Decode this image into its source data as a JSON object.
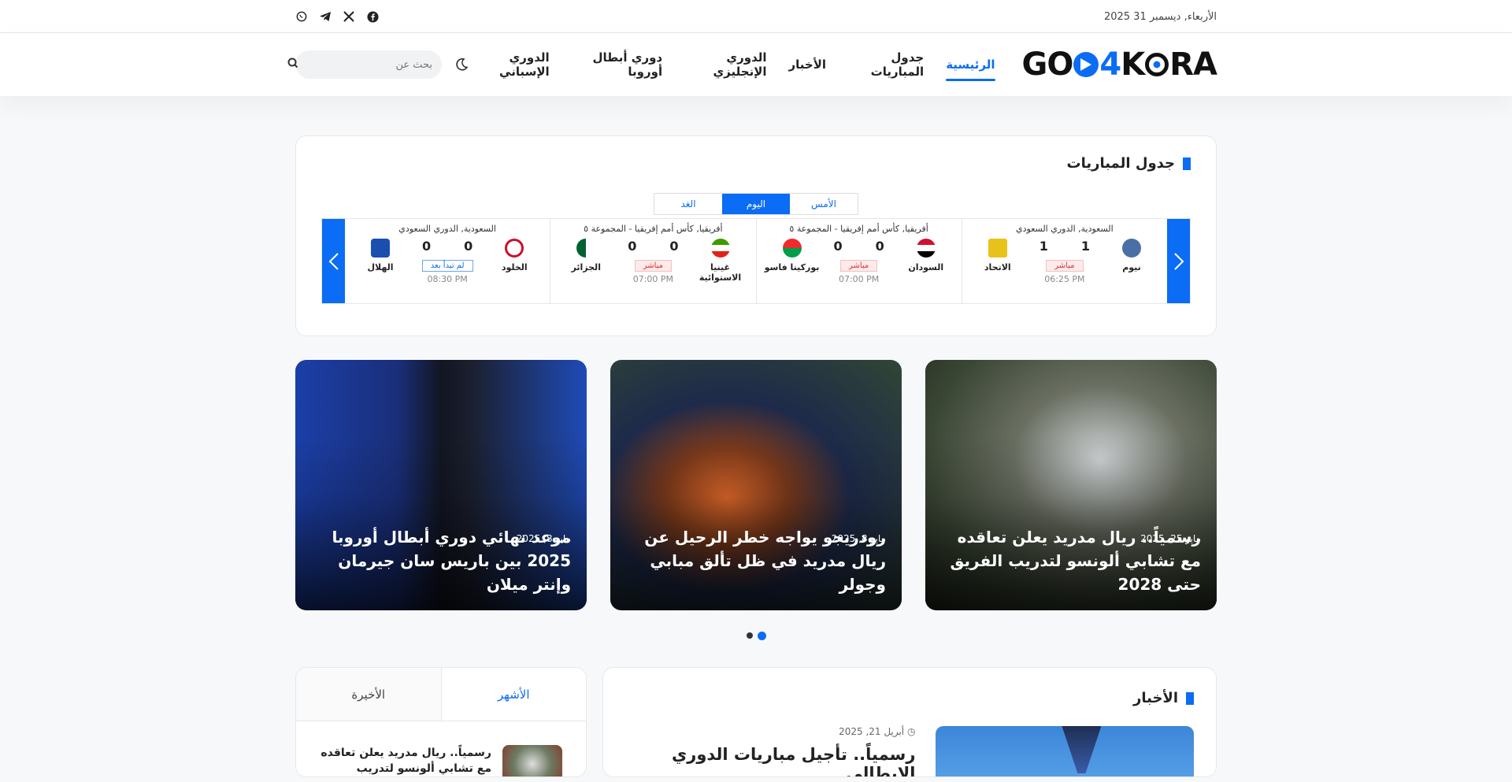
{
  "topbar": {
    "date": "الأربعاء, ديسمبر 31 2025",
    "social": [
      "facebook-icon",
      "x-icon",
      "telegram-icon",
      "whatsapp-icon"
    ]
  },
  "header": {
    "logo": {
      "go": "GO",
      "four": "4",
      "k": "K",
      "ra": "RA"
    },
    "nav": [
      "الرئيسية",
      "جدول المباريات",
      "الأخبار",
      "الدوري الإنجليزي",
      "دوري أبطال أوروبا",
      "الدوري الإسباني"
    ],
    "search_placeholder": "بحث عن"
  },
  "matches": {
    "title": "جدول المباريات",
    "tabs": [
      "الأمس",
      "اليوم",
      "الغد"
    ],
    "active_tab": "اليوم",
    "games": [
      {
        "league": "السعودية, الدوري السعودي",
        "home": "نيوم",
        "away": "الاتحاد",
        "home_score": "1",
        "away_score": "1",
        "status": "مباشر",
        "time": "06:25 PM",
        "home_color": "#4a6fa5",
        "away_color": "#e8c21a"
      },
      {
        "league": "أفريقيا, كأس أمم إفريقيا - المجموعة ٥",
        "home": "السودان",
        "away": "بوركينا فاسو",
        "home_score": "0",
        "away_score": "0",
        "status": "مباشر",
        "time": "07:00 PM",
        "home_color": "#d21034",
        "away_color": "#009e49"
      },
      {
        "league": "أفريقيا, كأس أمم إفريقيا - المجموعة ٥",
        "home": "غينيا الاستوائية",
        "away": "الجزائر",
        "home_score": "0",
        "away_score": "0",
        "status": "مباشر",
        "time": "07:00 PM",
        "home_color": "#3e9a00",
        "away_color": "#006233"
      },
      {
        "league": "السعودية, الدوري السعودي",
        "home": "الخلود",
        "away": "الهلال",
        "home_score": "0",
        "away_score": "0",
        "status": "لم تبدأ بعد",
        "time": "08:30 PM",
        "home_color": "#c8102e",
        "away_color": "#1a4fb0"
      }
    ]
  },
  "features": [
    {
      "date": "مايو 25, 2025",
      "title": "رسمياً.. ريال مدريد يعلن تعاقده مع تشابي ألونسو لتدريب الفريق حتى 2028"
    },
    {
      "date": "مايو 8, 2025",
      "title": "رودريجو يواجه خطر الرحيل عن ريال مدريد في ظل تألق مبابي وجولر"
    },
    {
      "date": "مايو 8, 2025",
      "title": "موعد نهائي دوري أبطال أوروبا 2025 بين باريس سان جيرمان وإنتر ميلان"
    }
  ],
  "news": {
    "title": "الأخبار",
    "item_date": "أبريل 21, 2025",
    "item_title": "رسمياً.. تأجيل مباريات الدوري الإيطالي"
  },
  "sidebar": {
    "tabs": [
      "الأشهر",
      "الأخيرة"
    ],
    "item_title": "رسمياً.. ريال مدريد يعلن تعاقده مع تشابي ألونسو لتدريب الفريق"
  }
}
